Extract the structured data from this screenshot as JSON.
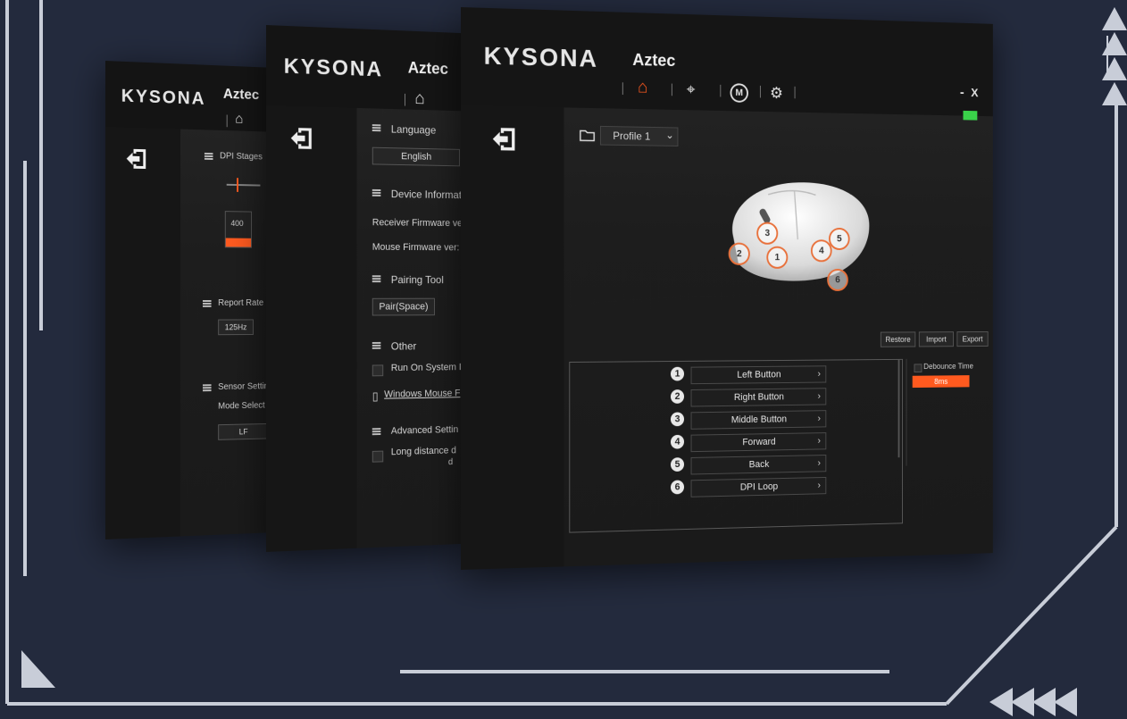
{
  "brand": "KYSONA",
  "model": "Aztec",
  "colors": {
    "background": "#232a3d",
    "accent": "#ff5a1f",
    "panel": "#1d1d1d",
    "deco_line": "#c8cdd8",
    "battery": "#3ad24a"
  },
  "panel_back": {
    "nav_icons": [
      "home-icon"
    ],
    "dpi_stages_label": "DPI Stages",
    "dpi_value": "400",
    "report_rate_label": "Report Rate",
    "report_rate_value": "125Hz",
    "sensor_settings_label": "Sensor Settin",
    "mode_select_label": "Mode Select",
    "mode_value": "LF"
  },
  "panel_mid": {
    "language_label": "Language",
    "language_value": "English",
    "device_info_label": "Device Informati",
    "receiver_fw_label": "Receiver Firmware ver",
    "mouse_fw_label": "Mouse Firmware ver:",
    "pairing_tool_label": "Pairing Tool",
    "pair_button": "Pair(Space)",
    "other_label": "Other",
    "run_on_startup_label": "Run On System I",
    "windows_mouse_label": "Windows Mouse F",
    "advanced_label": "Advanced Settin",
    "long_distance_label": "Long distance  d",
    "long_distance_label2": "d"
  },
  "panel_front": {
    "profile_selected": "Profile 1",
    "window_controls": {
      "minimize": "-",
      "close": "X"
    },
    "nav_icons": [
      "home-icon",
      "crosshair-icon",
      "macro-icon",
      "gear-icon"
    ],
    "actions": [
      "Restore",
      "Import",
      "Export"
    ],
    "debounce_label": "Debounce Time",
    "debounce_value": "8ms",
    "callouts": [
      "1",
      "2",
      "3",
      "4",
      "5",
      "6"
    ],
    "keys": [
      {
        "num": "1",
        "label": "Left Button"
      },
      {
        "num": "2",
        "label": "Right Button"
      },
      {
        "num": "3",
        "label": "Middle Button"
      },
      {
        "num": "4",
        "label": "Forward"
      },
      {
        "num": "5",
        "label": "Back"
      },
      {
        "num": "6",
        "label": "DPI Loop"
      }
    ],
    "chevron": "›"
  }
}
